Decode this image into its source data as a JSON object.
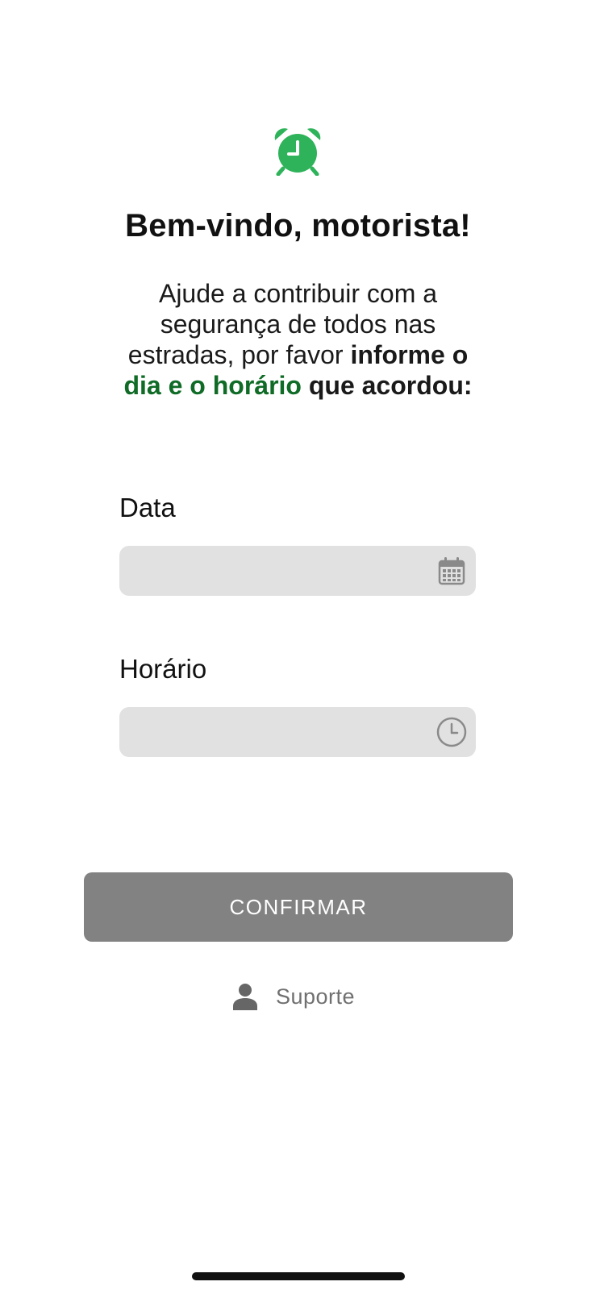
{
  "app": {
    "title": "Bem-vindo, motorista!",
    "subtitle": {
      "part1": "Ajude a contribuir com a segurança de todos nas estradas, por favor ",
      "part2_bold": "informe o ",
      "part3_green": "dia e o horário",
      "part4_bold": " que acordou:"
    }
  },
  "form": {
    "date": {
      "label": "Data",
      "value": "",
      "placeholder": ""
    },
    "time": {
      "label": "Horário",
      "value": "",
      "placeholder": ""
    }
  },
  "actions": {
    "confirm_label": "CONFIRMAR",
    "support_label": "Suporte"
  },
  "icons": {
    "alarm": "alarm-clock-icon",
    "date": "calendar-icon",
    "time": "clock-icon",
    "support": "person-icon"
  },
  "colors": {
    "accent_green": "#2fb35a",
    "highlight_green": "#0f6b26",
    "field_bg": "#e1e1e1",
    "button_bg": "#828282"
  }
}
